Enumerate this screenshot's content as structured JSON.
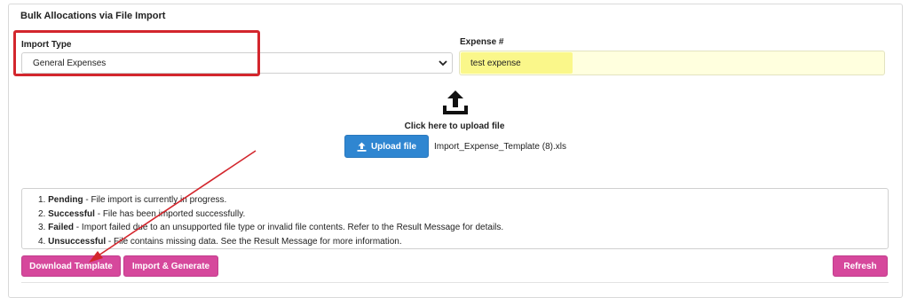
{
  "panel": {
    "title": "Bulk Allocations via File Import"
  },
  "import_type": {
    "label": "Import Type",
    "value": "General Expenses"
  },
  "expense": {
    "label": "Expense #",
    "value": "test expense"
  },
  "upload": {
    "hint": "Click here to upload file",
    "button_label": "Upload file",
    "filename": "Import_Expense_Template (8).xls"
  },
  "legend": [
    {
      "number": "1.",
      "status": "Pending",
      "text": " - File import is currently in progress."
    },
    {
      "number": "2.",
      "status": "Successful",
      "text": " - File has been imported successfully."
    },
    {
      "number": "3.",
      "status": "Failed",
      "text": " - Import failed due to an unsupported file type or invalid file contents. Refer to the Result Message for details."
    },
    {
      "number": "4.",
      "status": "Unsuccessful",
      "text": " - File contains missing data. See the Result Message for more information."
    }
  ],
  "actions": {
    "download_template": "Download Template",
    "import_generate": "Import & Generate",
    "refresh": "Refresh"
  },
  "colors": {
    "annotation_red": "#d3262d",
    "upload_blue": "#2f86d1",
    "action_pink": "#d6489c",
    "expense_bg": "#ffffde",
    "expense_highlight": "#faf78a"
  }
}
